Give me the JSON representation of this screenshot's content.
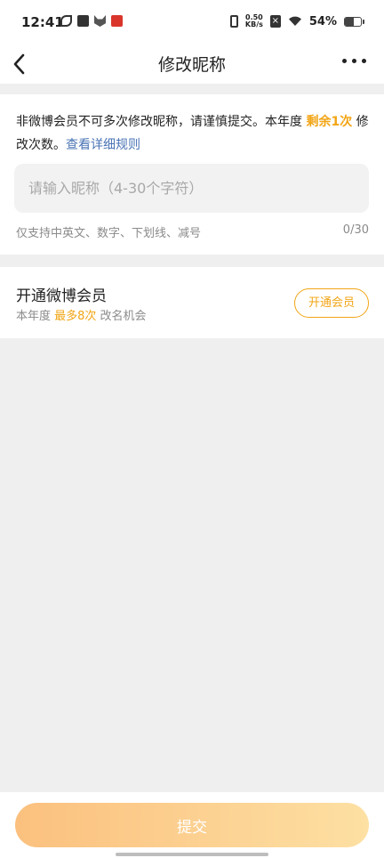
{
  "status_bar": {
    "time": "12:41",
    "net_speed_value": "0.50",
    "net_speed_unit": "KB/s",
    "battery_text": "54%",
    "battery_level": 0.54,
    "left_icons": [
      "leaf-icon",
      "mail-icon",
      "fox-icon",
      "red-app-icon"
    ],
    "right_icons": [
      "vibrate-icon",
      "no-sim-icon",
      "wifi-icon",
      "battery-icon"
    ]
  },
  "nav": {
    "title": "修改昵称",
    "back_icon": "back-chevron-icon",
    "more_icon": "more-dots-icon"
  },
  "notice": {
    "text_part1": "非微博会员不可多次修改昵称，请谨慎提交。本年度 ",
    "highlight": "剩余1次",
    "text_part2": " 修改次数。",
    "link": "查看详细规则"
  },
  "nickname_input": {
    "value": "",
    "placeholder": "请输入昵称（4-30个字符）",
    "hint": "仅支持中英文、数字、下划线、减号",
    "counter": "0/30"
  },
  "vip": {
    "title": "开通微博会员",
    "sub_part1": "本年度 ",
    "sub_highlight": "最多8次",
    "sub_part2": " 改名机会",
    "button_label": "开通会员"
  },
  "submit": {
    "label": "提交"
  },
  "colors": {
    "accent": "#f2a516",
    "link": "#4a74b5",
    "background": "#efefef",
    "submit_gradient_start": "#fbc07e",
    "submit_gradient_end": "#fde0a3"
  }
}
